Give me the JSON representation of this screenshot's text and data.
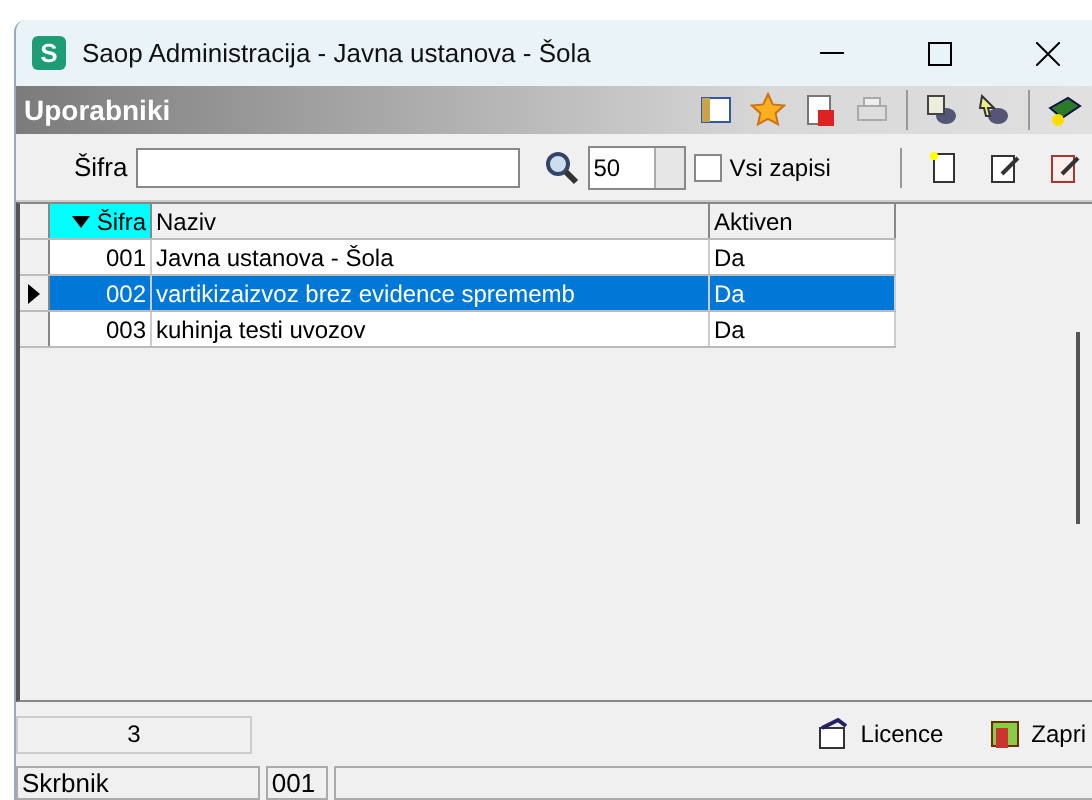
{
  "window": {
    "title": "Saop Administracija - Javna ustanova - Šola",
    "logo": "S"
  },
  "header": {
    "title": "Uporabniki"
  },
  "filter": {
    "label": "Šifra",
    "page_size": "50",
    "all_records": {
      "label": "Vsi zapisi",
      "checked": false
    }
  },
  "table": {
    "columns": [
      {
        "label": "Šifra",
        "sorted": true
      },
      {
        "label": "Naziv",
        "sorted": false
      },
      {
        "label": "Aktiven",
        "sorted": false
      }
    ],
    "rows": [
      {
        "code": "001",
        "name": "Javna ustanova - Šola",
        "active": "Da",
        "selected": false
      },
      {
        "code": "002",
        "name": "vartikizaizvoz brez evidence sprememb",
        "active": "Da",
        "selected": true
      },
      {
        "code": "003",
        "name": "kuhinja testi uvozov",
        "active": "Da",
        "selected": false
      }
    ]
  },
  "count": "3",
  "buttons": [
    {
      "label": "Licence",
      "kind": "licence"
    },
    {
      "label": "Zapri",
      "kind": "close"
    }
  ],
  "status_bar": [
    "Skrbnik",
    "001"
  ]
}
